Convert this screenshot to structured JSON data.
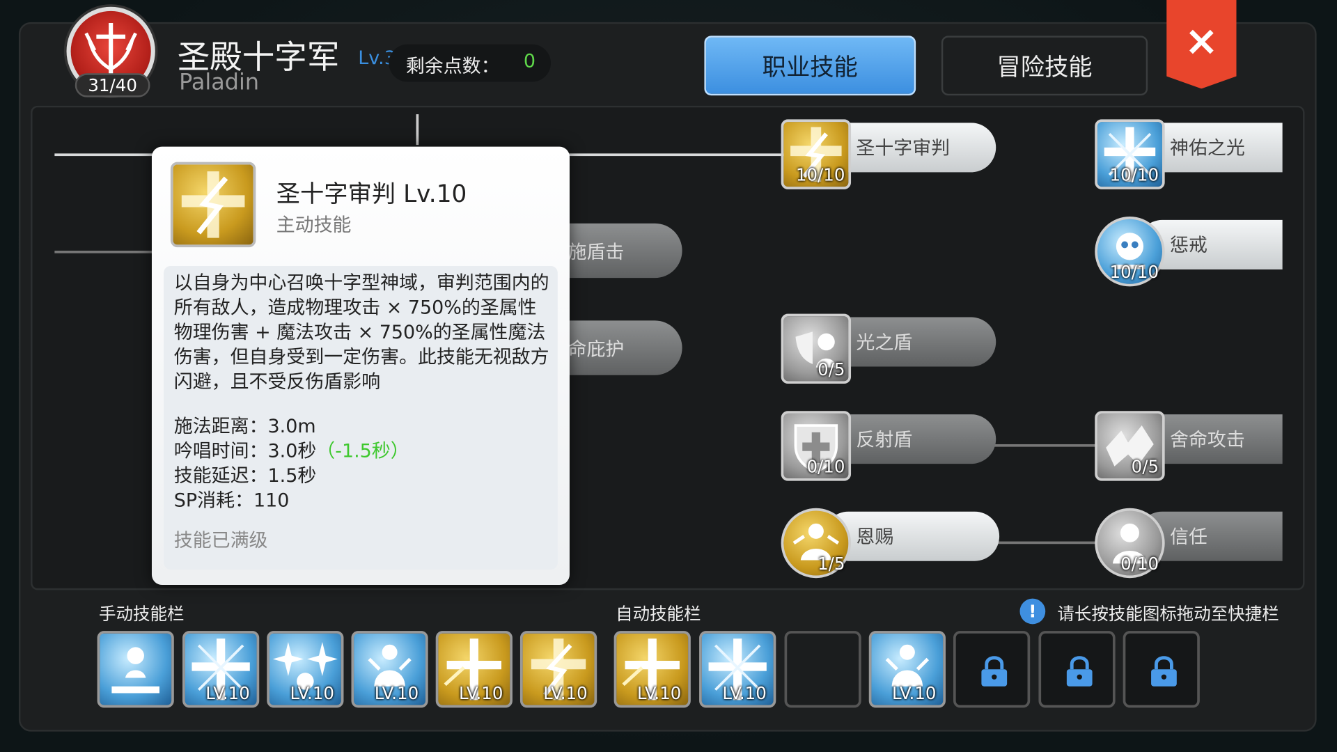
{
  "header": {
    "emblem_count": "31/40",
    "class_name": "圣殿十字军",
    "class_level": "Lv.31",
    "class_name_en": "Paladin",
    "points_label": "剩余点数：",
    "points_value": "0",
    "tab_job": "职业技能",
    "tab_adventure": "冒险技能",
    "close_icon": "×"
  },
  "tree": {
    "ghost_1": "施盾击",
    "ghost_2": "命庇护",
    "nodes": [
      {
        "name": "圣十字审判",
        "level": "10/10",
        "icon": "gold-lightning-cross-icon"
      },
      {
        "name": "神佑之光",
        "level": "10/10",
        "icon": "blue-holy-cross-icon"
      },
      {
        "name": "惩戒",
        "level": "10/10",
        "icon": "blue-skull-icon"
      },
      {
        "name": "光之盾",
        "level": "0/5",
        "icon": "grey-light-shield-icon"
      },
      {
        "name": "反射盾",
        "level": "0/10",
        "icon": "grey-reflect-shield-icon"
      },
      {
        "name": "舍命攻击",
        "level": "0/5",
        "icon": "grey-sacrifice-icon"
      },
      {
        "name": "恩赐",
        "level": "1/5",
        "icon": "gold-grace-icon"
      },
      {
        "name": "信任",
        "level": "0/10",
        "icon": "grey-trust-icon"
      }
    ]
  },
  "tooltip": {
    "title": "圣十字审判  Lv.10",
    "type": "主动技能",
    "description": "以自身为中心召唤十字型神域，审判范围内的所有敌人，造成物理攻击 × 750%的圣属性物理伤害 + 魔法攻击 × 750%的圣属性魔法伤害，但自身受到一定伤害。此技能无视敌方闪避，且不受反伤盾影响",
    "range": "施法距离：3.0m",
    "cast_time": "吟唱时间：3.0秒",
    "cast_bonus": "（-1.5秒）",
    "delay": "技能延迟：1.5秒",
    "sp_cost": "SP消耗：110",
    "maxed": "技能已满级"
  },
  "bottom": {
    "manual_label": "手动技能栏",
    "auto_label": "自动技能栏",
    "hint_icon": "!",
    "hint": "请长按技能图标拖动至快捷栏",
    "manual_slots": [
      {
        "icon": "blue-resurrect-icon",
        "level": ""
      },
      {
        "icon": "blue-holy-cross-icon",
        "level": "LV.10"
      },
      {
        "icon": "blue-stars-icon",
        "level": "LV.10"
      },
      {
        "icon": "blue-blessing-icon",
        "level": "LV.10"
      },
      {
        "icon": "gold-cross-icon",
        "level": "LV.10"
      },
      {
        "icon": "gold-lightning-cross-icon",
        "level": "LV.10"
      }
    ],
    "auto_slots": [
      {
        "icon": "gold-cross-icon",
        "level": "LV.10"
      },
      {
        "icon": "blue-holy-cross-icon",
        "level": "LV.10"
      },
      {
        "icon": "empty-slot",
        "level": ""
      },
      {
        "icon": "blue-blessing-icon",
        "level": "LV.10"
      },
      {
        "icon": "lock-icon",
        "level": ""
      },
      {
        "icon": "lock-icon",
        "level": ""
      },
      {
        "icon": "lock-icon",
        "level": ""
      }
    ]
  },
  "colors": {
    "accent_blue": "#3c8fe0",
    "close_red": "#e8452c",
    "points_green": "#5fd84a",
    "gold": "#c99a1e"
  }
}
